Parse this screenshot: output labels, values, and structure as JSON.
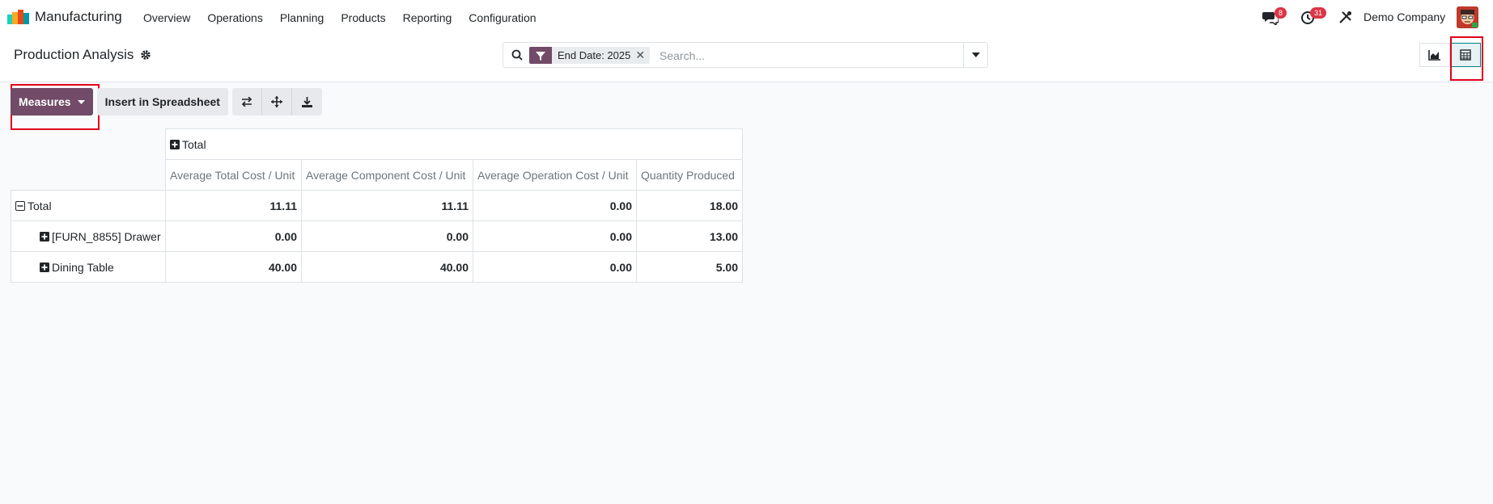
{
  "navbar": {
    "app_name": "Manufacturing",
    "menu": [
      "Overview",
      "Operations",
      "Planning",
      "Products",
      "Reporting",
      "Configuration"
    ],
    "messages_badge": "8",
    "activities_badge": "31",
    "company": "Demo Company"
  },
  "control_panel": {
    "title": "Production Analysis",
    "search": {
      "facet": "End Date: 2025",
      "placeholder": "Search..."
    }
  },
  "toolbar": {
    "measures_label": "Measures",
    "insert_label": "Insert in Spreadsheet"
  },
  "pivot": {
    "column_group": "Total",
    "measures": [
      "Average Total Cost / Unit",
      "Average Component Cost / Unit",
      "Average Operation Cost / Unit",
      "Quantity Produced"
    ],
    "rows": [
      {
        "label": "Total",
        "values": [
          "11.11",
          "11.11",
          "0.00",
          "18.00"
        ]
      },
      {
        "label": "[FURN_8855] Drawer",
        "values": [
          "0.00",
          "0.00",
          "0.00",
          "13.00"
        ]
      },
      {
        "label": "Dining Table",
        "values": [
          "40.00",
          "40.00",
          "0.00",
          "5.00"
        ]
      }
    ]
  },
  "colors": {
    "brand": "#714b67",
    "badge": "#dc3545",
    "highlight": "#e0001b"
  }
}
